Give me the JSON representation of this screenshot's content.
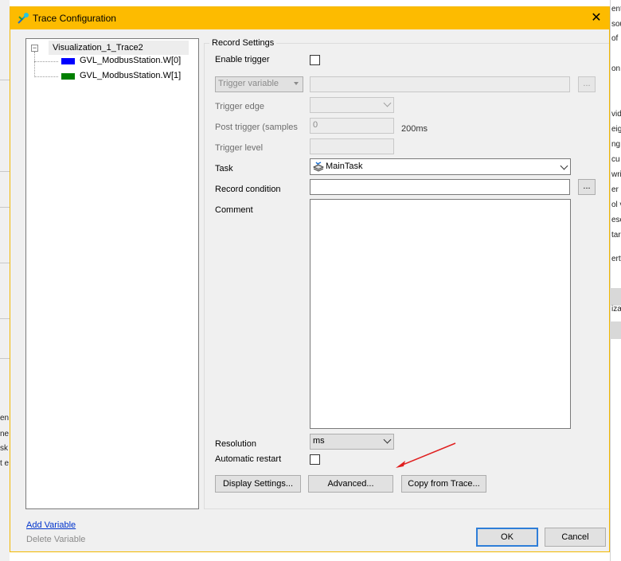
{
  "window": {
    "title": "Trace Configuration"
  },
  "background": {
    "left_fragments": [
      "en",
      "ne",
      "sk",
      "t e"
    ],
    "right_fragments": [
      "ent",
      "sou",
      "of",
      "on",
      "vidt",
      "eig",
      "ng",
      "cu",
      "wri",
      "er",
      "ol v",
      "esc",
      "tar",
      "erty",
      "izat"
    ]
  },
  "tree": {
    "root": "Visualization_1_Trace2",
    "variables": [
      {
        "label": "GVL_ModbusStation.W[0]",
        "color": "#0000ff"
      },
      {
        "label": "GVL_ModbusStation.W[1]",
        "color": "#007f00"
      }
    ]
  },
  "record_settings": {
    "group_title": "Record Settings",
    "enable_trigger_label": "Enable trigger",
    "trigger_variable_placeholder": "Trigger variable",
    "trigger_variable_button": "...",
    "trigger_edge_label": "Trigger edge",
    "post_trigger_label": "Post trigger (samples",
    "post_trigger_value": "0",
    "post_trigger_suffix": "200ms",
    "trigger_level_label": "Trigger  level",
    "task_label": "Task",
    "task_value": "MainTask",
    "record_condition_label": "Record condition",
    "record_condition_button": "...",
    "comment_label": "Comment",
    "resolution_label": "Resolution",
    "resolution_value": "ms",
    "automatic_restart_label": "Automatic restart"
  },
  "buttons": {
    "display_settings": "Display Settings...",
    "advanced": "Advanced...",
    "copy_from_trace": "Copy from Trace...",
    "ok": "OK",
    "cancel": "Cancel"
  },
  "links": {
    "add_variable": "Add Variable",
    "delete_variable": "Delete Variable"
  },
  "colors": {
    "titlebar": "#fdbb00",
    "annotation_arrow": "#e02020"
  }
}
